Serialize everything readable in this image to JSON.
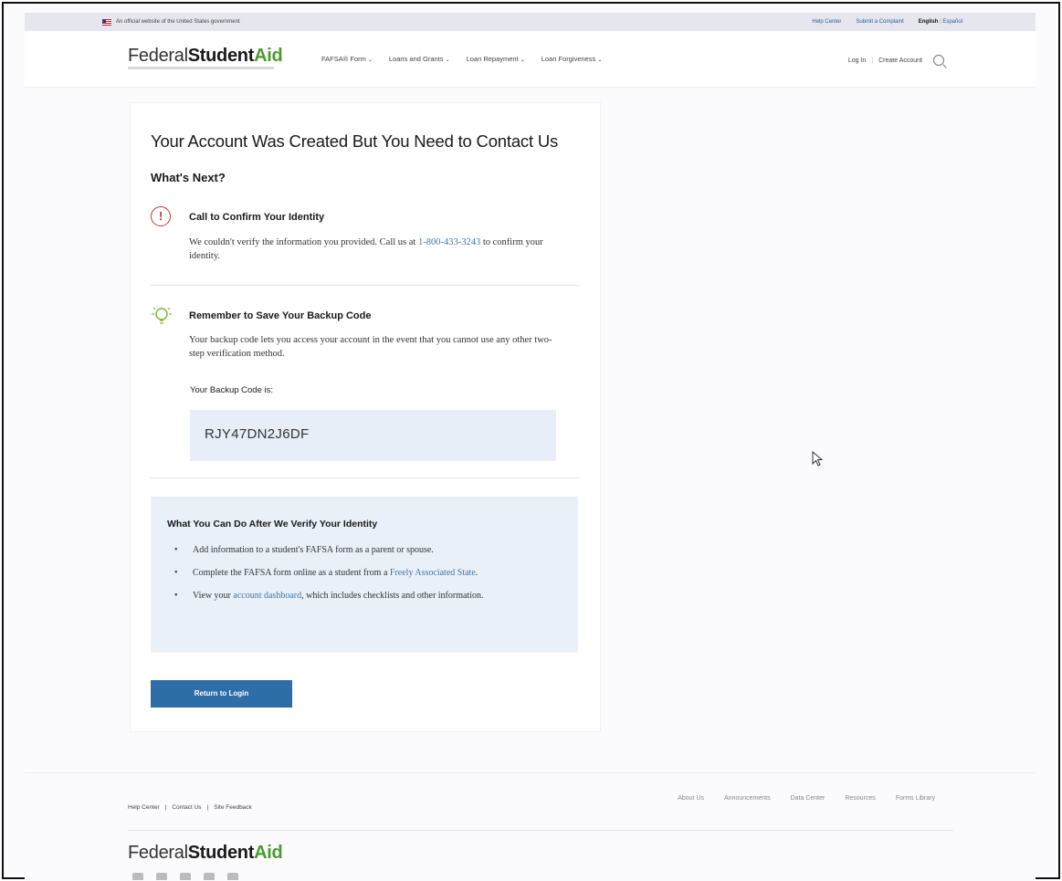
{
  "gov_banner": {
    "text": "An official website of the United States government",
    "links": [
      "Help Center",
      "Submit a Complaint"
    ],
    "lang_en": "English",
    "lang_es": "Español"
  },
  "header": {
    "logo": {
      "part1": "Federal",
      "part2": "Student",
      "part3": "Aid"
    },
    "nav": [
      "FAFSA® Form",
      "Loans and Grants",
      "Loan Repayment",
      "Loan Forgiveness"
    ],
    "nav_chevron": "⌄",
    "login": "Log In",
    "separator": "|",
    "create_account": "Create Account",
    "search_icon": "search-icon"
  },
  "main": {
    "title": "Your Account Was Created But You Need to Contact Us",
    "subtitle": "What's Next?",
    "alert_section": {
      "icon": "alert-circle-icon",
      "icon_glyph": "!",
      "heading": "Call to Confirm Your Identity",
      "text_before": "We couldn't verify the information you provided. Call us at ",
      "phone": "1-800-433-3243",
      "text_after": " to confirm your identity."
    },
    "backup_section": {
      "icon": "lightbulb-icon",
      "heading": "Remember to Save Your Backup Code",
      "text": "Your backup code lets you access your account in the event that you cannot use any other two-step verification method.",
      "code_label": "Your Backup Code is:",
      "code": "RJY47DN2J6DF"
    },
    "after_verify": {
      "title": "What You Can Do After We Verify Your Identity",
      "item1": "Add information to a student's FAFSA form as a parent or spouse.",
      "item2_before": "Complete the FAFSA form online as a student from a ",
      "item2_link": "Freely Associated State",
      "item2_after": ".",
      "item3_before": "View your ",
      "item3_link": "account dashboard",
      "item3_after": ", which includes checklists and other information."
    },
    "return_button": "Return to Login"
  },
  "footer": {
    "left_links": [
      "Help Center",
      "Contact Us",
      "Site Feedback"
    ],
    "separator": "|",
    "right_links": [
      "About Us",
      "Announcements",
      "Data Center",
      "Resources",
      "Forms Library"
    ],
    "logo": {
      "part1": "Federal",
      "part2": "Student",
      "part3": "Aid"
    }
  },
  "colors": {
    "primary_button": "#2e6ea6",
    "link": "#3c78a8",
    "alert": "#c0392b",
    "brand_green": "#4a9a2f",
    "info_bg": "#eaf0f8"
  }
}
